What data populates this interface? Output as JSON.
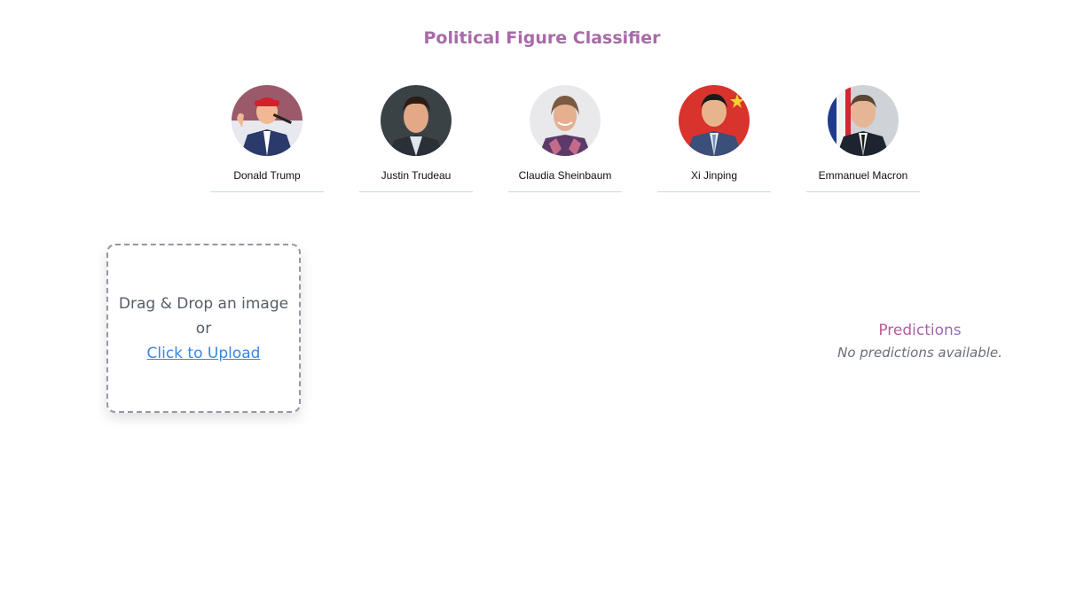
{
  "header": {
    "title": "Political Figure Classifier"
  },
  "figures": [
    {
      "name": "Donald Trump"
    },
    {
      "name": "Justin Trudeau"
    },
    {
      "name": "Claudia Sheinbaum"
    },
    {
      "name": "Xi Jinping"
    },
    {
      "name": "Emmanuel Macron"
    }
  ],
  "upload": {
    "line1": "Drag & Drop an image",
    "line2": "or",
    "link": "Click to Upload"
  },
  "predictions": {
    "title": "Predictions",
    "empty_text": "No predictions available."
  }
}
